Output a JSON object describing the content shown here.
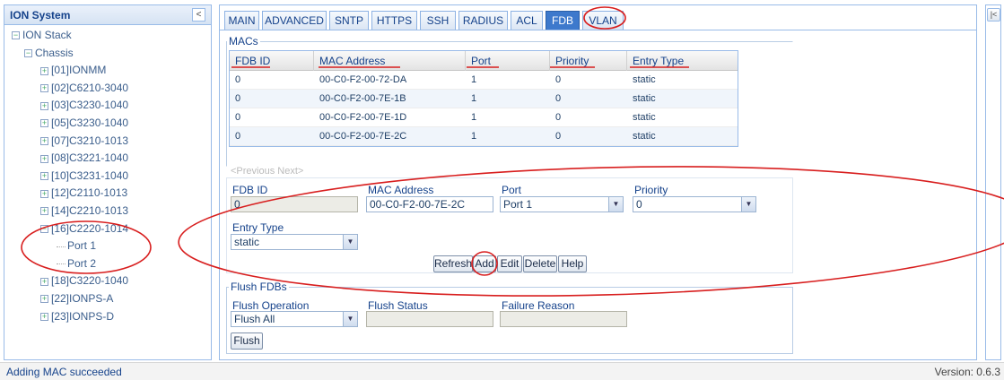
{
  "sidebar": {
    "title": "ION System",
    "collapse_icon": "<",
    "tree": [
      {
        "label": "ION Stack",
        "toggle": "−"
      },
      {
        "label": "Chassis",
        "toggle": "−"
      },
      {
        "label": "[01]IONMM",
        "toggle": "+"
      },
      {
        "label": "[02]C6210-3040",
        "toggle": "+"
      },
      {
        "label": "[03]C3230-1040",
        "toggle": "+"
      },
      {
        "label": "[05]C3230-1040",
        "toggle": "+"
      },
      {
        "label": "[07]C3210-1013",
        "toggle": "+"
      },
      {
        "label": "[08]C3221-1040",
        "toggle": "+"
      },
      {
        "label": "[10]C3231-1040",
        "toggle": "+"
      },
      {
        "label": "[12]C2110-1013",
        "toggle": "+"
      },
      {
        "label": "[14]C2210-1013",
        "toggle": "+"
      },
      {
        "label": "[16]C2220-1014",
        "toggle": "−"
      },
      {
        "label": "Port 1",
        "toggle": ""
      },
      {
        "label": "Port 2",
        "toggle": ""
      },
      {
        "label": "[18]C3220-1040",
        "toggle": "+"
      },
      {
        "label": "[22]IONPS-A",
        "toggle": "+"
      },
      {
        "label": "[23]IONPS-D",
        "toggle": "+"
      }
    ]
  },
  "right_strip": {
    "expand_icon": "|<"
  },
  "tabs": [
    "MAIN",
    "ADVANCED",
    "SNTP",
    "HTTPS",
    "SSH",
    "RADIUS",
    "ACL",
    "FDB",
    "VLAN"
  ],
  "active_tab": "FDB",
  "macs": {
    "title": "MACs",
    "columns": [
      "FDB ID",
      "MAC Address",
      "Port",
      "Priority",
      "Entry Type"
    ],
    "rows": [
      [
        "0",
        "00-C0-F2-00-72-DA",
        "1",
        "0",
        "static"
      ],
      [
        "0",
        "00-C0-F2-00-7E-1B",
        "1",
        "0",
        "static"
      ],
      [
        "0",
        "00-C0-F2-00-7E-1D",
        "1",
        "0",
        "static"
      ],
      [
        "0",
        "00-C0-F2-00-7E-2C",
        "1",
        "0",
        "static"
      ]
    ],
    "pager": "<Previous  Next>"
  },
  "form": {
    "fdb_id_label": "FDB ID",
    "fdb_id_value": "0",
    "mac_label": "MAC Address",
    "mac_value": "00-C0-F2-00-7E-2C",
    "port_label": "Port",
    "port_value": "Port 1",
    "priority_label": "Priority",
    "priority_value": "0",
    "entry_type_label": "Entry Type",
    "entry_type_value": "static",
    "buttons": {
      "refresh": "Refresh",
      "add": "Add",
      "edit": "Edit",
      "delete": "Delete",
      "help": "Help"
    }
  },
  "flush": {
    "title": "Flush FDBs",
    "operation_label": "Flush Operation",
    "operation_value": "Flush All",
    "status_label": "Flush Status",
    "status_value": "",
    "failure_label": "Failure Reason",
    "failure_value": "",
    "button": "Flush"
  },
  "statusbar": {
    "message": "Adding MAC succeeded",
    "version": "Version: 0.6.3"
  },
  "annotation_color": "#d81e1e",
  "accent_color": "#3d79cc"
}
